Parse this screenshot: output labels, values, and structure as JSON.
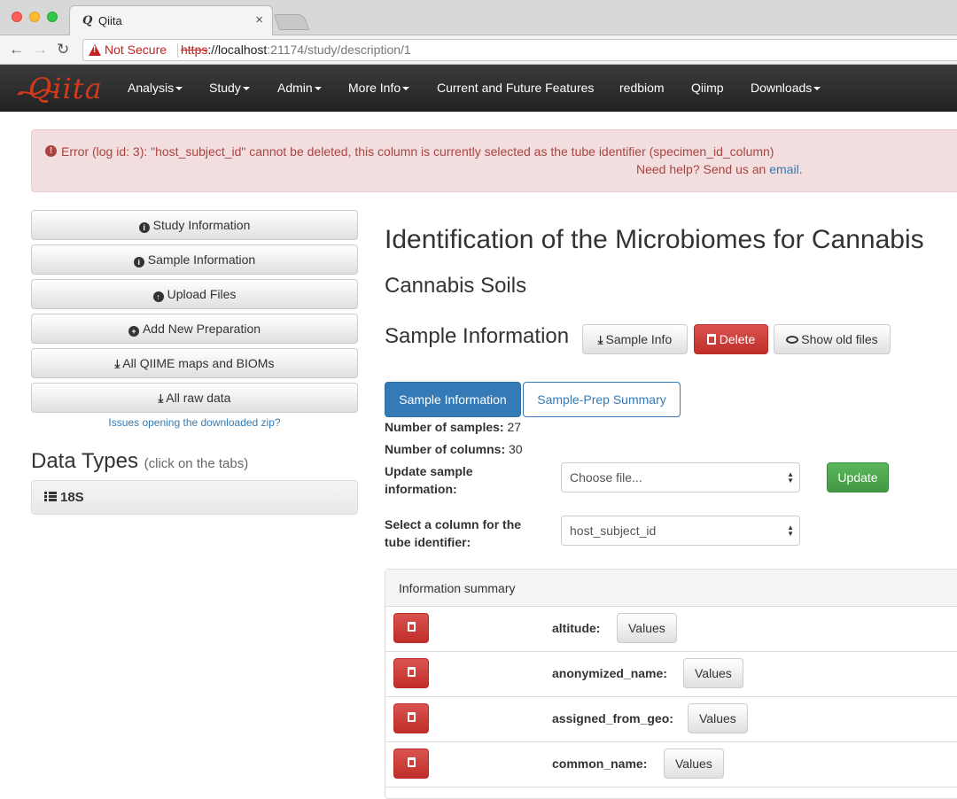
{
  "browser": {
    "tab_title": "Qiita",
    "tab_favicon": "Q",
    "security_label": "Not Secure",
    "url_protocol": "https",
    "url_host": "://localhost",
    "url_rest": ":21174/study/description/1"
  },
  "navbar": {
    "logo": "Qiita",
    "items": [
      {
        "label": "Analysis",
        "dropdown": true
      },
      {
        "label": "Study",
        "dropdown": true
      },
      {
        "label": "Admin",
        "dropdown": true
      },
      {
        "label": "More Info",
        "dropdown": true
      },
      {
        "label": "Current and Future Features",
        "dropdown": false
      },
      {
        "label": "redbiom",
        "dropdown": false
      },
      {
        "label": "Qiimp",
        "dropdown": false
      },
      {
        "label": "Downloads",
        "dropdown": true
      }
    ]
  },
  "alert": {
    "message": "Error (log id: 3): \"host_subject_id\" cannot be deleted, this column is currently selected as the tube identifier (specimen_id_column)",
    "help_prefix": "Need help? Send us an ",
    "help_link": "email",
    "help_suffix": "."
  },
  "sidebar": {
    "buttons": [
      {
        "label": "Study Information",
        "icon": "info-circle-icon"
      },
      {
        "label": "Sample Information",
        "icon": "info-circle-icon"
      },
      {
        "label": "Upload Files",
        "icon": "upload-circle-icon"
      },
      {
        "label": "Add New Preparation",
        "icon": "plus-circle-icon"
      },
      {
        "label": "All QIIME maps and BIOMs",
        "icon": "download-icon"
      },
      {
        "label": "All raw data",
        "icon": "download-icon"
      }
    ],
    "help_link": "Issues opening the downloaded zip?",
    "data_types_title": "Data Types",
    "data_types_sub": "(click on the tabs)",
    "data_types": [
      "18S"
    ]
  },
  "main": {
    "study_title": "Identification of the Microbiomes for Cannabis",
    "study_alias": "Cannabis Soils",
    "section_title": "Sample Information",
    "actions": {
      "sample_info": "Sample Info",
      "delete": "Delete",
      "show_old": "Show old files"
    },
    "tabs": [
      "Sample Information",
      "Sample-Prep Summary"
    ],
    "stats": {
      "samples_label": "Number of samples:",
      "samples_value": "27",
      "columns_label": "Number of columns:",
      "columns_value": "30"
    },
    "update_label": "Update sample information:",
    "file_select": "Choose file...",
    "update_button": "Update",
    "tube_label": "Select a column for the tube identifier:",
    "tube_select": "host_subject_id",
    "summary": {
      "title": "Information summary",
      "values_label": "Values",
      "rows": [
        "altitude:",
        "anonymized_name:",
        "assigned_from_geo:",
        "common_name:"
      ]
    }
  },
  "colors": {
    "primary": "#337ab7",
    "danger": "#d9534f",
    "success": "#5cb85c",
    "alert_bg": "#f2dede",
    "alert_text": "#a94442"
  }
}
